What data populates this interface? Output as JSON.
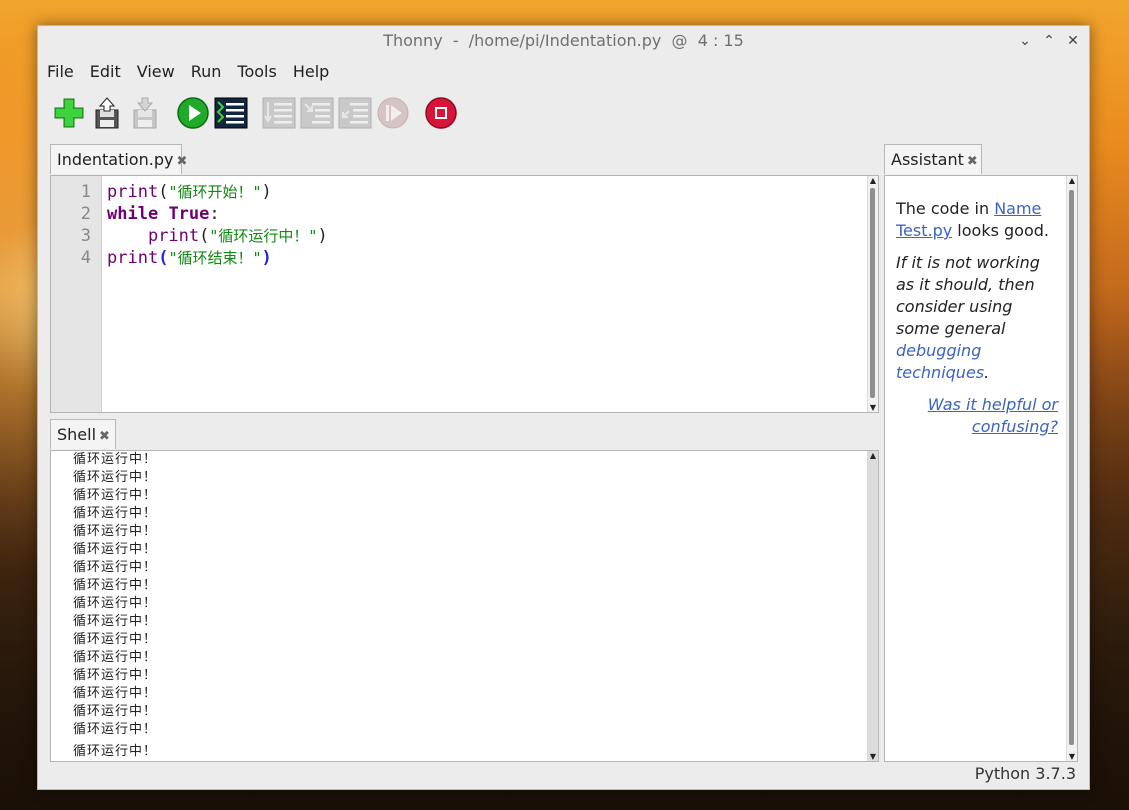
{
  "window": {
    "title": "Thonny  -  /home/pi/Indentation.py  @  4 : 15"
  },
  "win_controls": {
    "minimize": "⌄",
    "maximize": "⌃",
    "close": "✕"
  },
  "menu": [
    "File",
    "Edit",
    "View",
    "Run",
    "Tools",
    "Help"
  ],
  "toolbar": {
    "buttons": [
      "new",
      "load",
      "save",
      "run",
      "debug",
      "step-over",
      "step-into",
      "step-out",
      "resume",
      "stop"
    ],
    "disabled": [
      "save",
      "step-over",
      "step-into",
      "step-out",
      "resume"
    ],
    "colors": {
      "new": "#2fbf2f",
      "run": "#1faa2a",
      "stop": "#d8143a",
      "disabled": "#c7c7c7"
    }
  },
  "editor": {
    "tab_label": "Indentation.py",
    "close_glyph": "✖",
    "line_numbers": [
      "1",
      "2",
      "3",
      "4"
    ],
    "lines": [
      {
        "indent": "",
        "fn": "print",
        "open": "(",
        "str": "\"循环开始！\"",
        "close": ")"
      },
      {
        "kw1": "while",
        "kw2": "True",
        "colon": ":"
      },
      {
        "indent": "    ",
        "fn": "print",
        "open": "(",
        "str": "\"循环运行中！\"",
        "close": ")"
      },
      {
        "indent": "",
        "fn": "print",
        "open": "(",
        "str": "\"循环结束！\"",
        "close": ")"
      }
    ]
  },
  "shell": {
    "tab_label": "Shell",
    "close_glyph": "✖",
    "lines": [
      "循环运行中！",
      "循环运行中！",
      "循环运行中！",
      "循环运行中！",
      "循环运行中！",
      "循环运行中！",
      "循环运行中！",
      "循环运行中！",
      "循环运行中！",
      "循环运行中！",
      "循环运行中！",
      "循环运行中！",
      "循环运行中！",
      "循环运行中！",
      "循环运行中！",
      "循环运行中！",
      "循环运行中！"
    ]
  },
  "assistant": {
    "tab_label": "Assistant",
    "close_glyph": "✖",
    "p1_pre": "The code in ",
    "p1_link": "Name Test.py",
    "p1_post": " looks good.",
    "p2_text": "If it is not working as it should, then consider using some general ",
    "p2_link": "debugging techniques",
    "p2_end": ".",
    "feedback_link": "Was it helpful or confusing?"
  },
  "status": {
    "python_version": "Python 3.7.3"
  }
}
